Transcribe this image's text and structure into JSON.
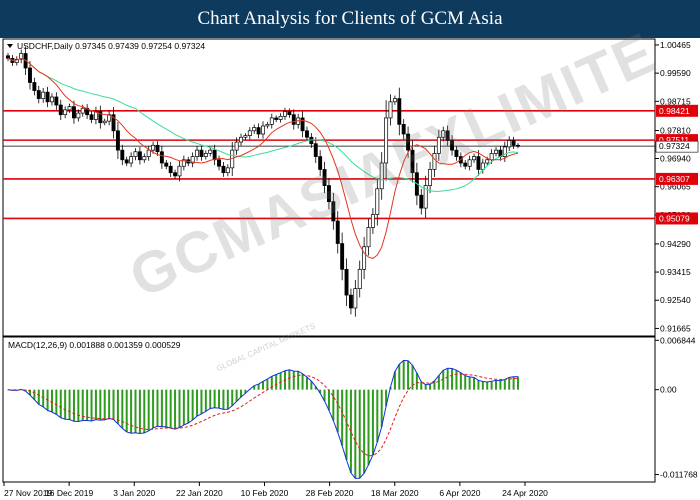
{
  "header": {
    "title": "Chart Analysis for Clients of GCM Asia"
  },
  "colors": {
    "header_bg": "#0e3a5e",
    "level_line": "#e0000a",
    "sma_fast": "#e8341c",
    "sma_slow": "#3ddc97",
    "bull": "#000000",
    "bear": "#000000",
    "hist": "#2e9a1e",
    "macd_main": "#1030e0",
    "macd_signal": "#e0201a",
    "price_tag_bg": "#e0000a",
    "current_tag_bg": "#ffffff"
  },
  "watermark": {
    "text": "GCMASIAFXLIMITE",
    "sub": "GLOBAL CAPITAL MARKETS"
  },
  "chart_data": [
    {
      "type": "candlestick",
      "symbol_label": "USDCHF,Daily",
      "ohlc_label": "0.97345 0.97439 0.97254 0.97324",
      "ylim": [
        0.9143,
        1.0065
      ],
      "y_ticks": [
        "1.00465",
        "0.99590",
        "0.98715",
        "0.97810",
        "0.96940",
        "0.96065",
        "0.95190",
        "0.94290",
        "0.93415",
        "0.92540",
        "0.91665"
      ],
      "levels": [
        {
          "label": "0.98421",
          "value": 0.98421
        },
        {
          "label": "0.97511",
          "value": 0.97511
        },
        {
          "label": "0.96307",
          "value": 0.96307
        },
        {
          "label": "0.95079",
          "value": 0.95079
        }
      ],
      "current": {
        "label": "0.97324",
        "value": 0.97324
      },
      "x_labels": [
        "27 Nov 2019",
        "16 Dec 2019",
        "3 Jan 2020",
        "22 Jan 2020",
        "10 Feb 2020",
        "28 Feb 2020",
        "18 Mar 2020",
        "6 Apr 2020",
        "24 Apr 2020"
      ],
      "closes": [
        1.0005,
        0.9992,
        1.0002,
        1.002,
        0.9975,
        0.993,
        0.9905,
        0.988,
        0.99,
        0.987,
        0.9885,
        0.986,
        0.983,
        0.9845,
        0.9855,
        0.982,
        0.9835,
        0.985,
        0.983,
        0.9815,
        0.984,
        0.9805,
        0.981,
        0.983,
        0.978,
        0.972,
        0.969,
        0.968,
        0.97,
        0.9715,
        0.969,
        0.97,
        0.972,
        0.9735,
        0.9715,
        0.968,
        0.967,
        0.965,
        0.964,
        0.967,
        0.969,
        0.968,
        0.97,
        0.972,
        0.97,
        0.971,
        0.972,
        0.969,
        0.967,
        0.965,
        0.9665,
        0.972,
        0.9745,
        0.976,
        0.9765,
        0.978,
        0.979,
        0.977,
        0.9795,
        0.98,
        0.982,
        0.9815,
        0.9825,
        0.984,
        0.983,
        0.98,
        0.982,
        0.978,
        0.976,
        0.974,
        0.97,
        0.966,
        0.961,
        0.956,
        0.95,
        0.943,
        0.935,
        0.927,
        0.923,
        0.929,
        0.935,
        0.942,
        0.948,
        0.952,
        0.96,
        0.968,
        0.982,
        0.987,
        0.988,
        0.98,
        0.977,
        0.972,
        0.965,
        0.958,
        0.954,
        0.961,
        0.966,
        0.971,
        0.976,
        0.978,
        0.975,
        0.972,
        0.97,
        0.968,
        0.967,
        0.969,
        0.97,
        0.966,
        0.968,
        0.969,
        0.971,
        0.972,
        0.97,
        0.973,
        0.975,
        0.9735,
        0.97324
      ]
    },
    {
      "type": "line",
      "label": "MACD(12,26,9) 0.001888 0.001359 0.000529",
      "ylim": [
        -0.0128,
        0.0073
      ],
      "y_ticks": [
        "0.006844",
        "0.00",
        "-0.011768"
      ]
    }
  ],
  "x_axis_dates": [
    "27 Nov 2019",
    "16 Dec 2019",
    "3 Jan 2020",
    "22 Jan 2020",
    "10 Feb 2020",
    "28 Feb 2020",
    "18 Mar 2020",
    "6 Apr 2020",
    "24 Apr 2020"
  ]
}
